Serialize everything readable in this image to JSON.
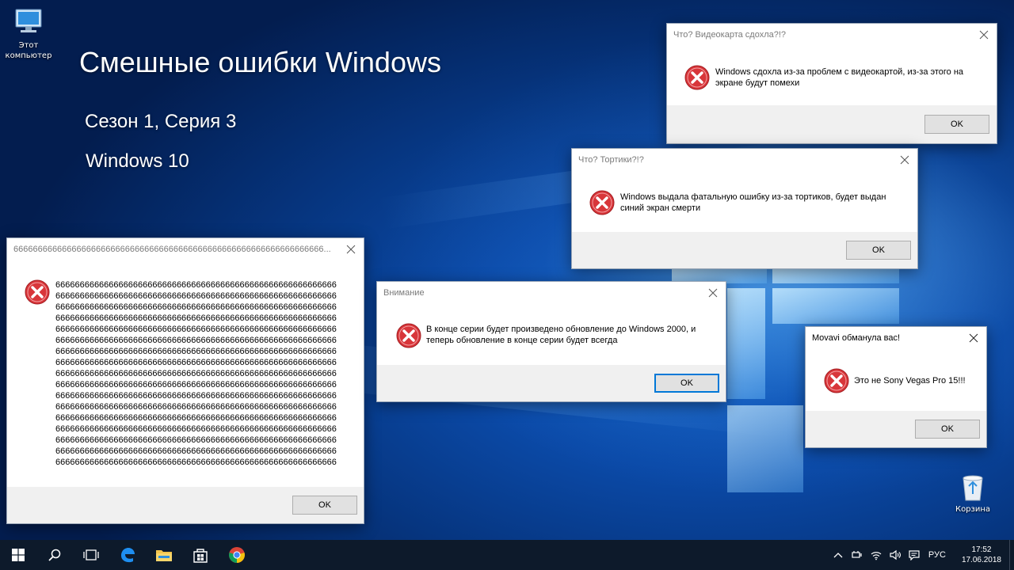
{
  "desktop": {
    "icons": {
      "computer": {
        "label_line1": "Этот",
        "label_line2": "компьютер"
      },
      "recycle": {
        "label": "Корзина"
      }
    },
    "overlay": {
      "title": "Смешные ошибки Windows",
      "subtitle1": "Сезон 1, Серия 3",
      "subtitle2": "Windows 10"
    }
  },
  "dialogs": {
    "videocard": {
      "title": "Что? Видеокарта сдохла?!?",
      "line1": "Windows сдохла из-за проблем с видеокартой, из-за этого на",
      "line2": "экране будут помехи",
      "ok": "OK"
    },
    "cakes": {
      "title": "Что? Тортики?!?",
      "line1": "Windows выдала фатальную ошибку из-за тортиков, будет выдан",
      "line2": "синий экран смерти",
      "ok": "OK"
    },
    "sixes": {
      "title": "6666666666666666666666666666666666666666666666666666666666666666...",
      "message": "6666666666666666666666666666666666666666666666666666666666666666666666666666666666666666666666666666666666666666666666666666666666666666666666666666666666666666666666666666666666666666666666666666666666666666666666666666666666666666666666666666666666666666666666666666666666666666666666666666666666666666666666666666666666666666666666666666666666666666666666666666666666666666666666666666666666666666666666666666666666666666666666666666666666666666666666666666666666666666666666666666666666666666666666666666666666666666666666666666666666666666666666666666666666666666666666666666666666666666666666666666666666666666666666666666666666666666666666666666666666666666666666666666666666666666666666666666666666666666666666666666666666666666666666666666666666666666666666666666666666666666666666666666666666666666666666666666666666666666666666666666666666666666666666666666666666666666666666666666666666666666666666666666666666666666666666666666666666666666666666666666666666666666666666666666666666666666666666666666666666666666666666666666666666666666666666666666666666666666666666666666666666666666666666666666666666666666666666666666666666666666666666666666666666666666666666666666666666666666666666666666666666666666666666666666666666666666666666666666666666666666666666666666666666666666666666666666666666666666666666666666666666666666666666666666666666666666666666666666666666666666666666666666666666666666666666666666666666666666",
      "ok": "OK"
    },
    "warning": {
      "title": "Внимание",
      "line1": "В конце серии будет произведено обновление до Windows 2000, и",
      "line2": "теперь обновление в конце серии будет всегда",
      "ok": "OK"
    },
    "movavi": {
      "title": "Movavi обманула вас!",
      "message": "Это не Sony Vegas Pro 15!!!",
      "ok": "OK"
    }
  },
  "taskbar": {
    "language": "РУС",
    "time": "17:52",
    "date": "17.06.2018"
  },
  "icons": {
    "error": "error-icon",
    "close": "close-icon",
    "start": "windows-start-icon",
    "search": "search-icon",
    "taskview": "task-view-icon",
    "edge": "edge-browser-icon",
    "explorer": "file-explorer-icon",
    "store": "store-icon",
    "chrome": "chrome-icon"
  }
}
